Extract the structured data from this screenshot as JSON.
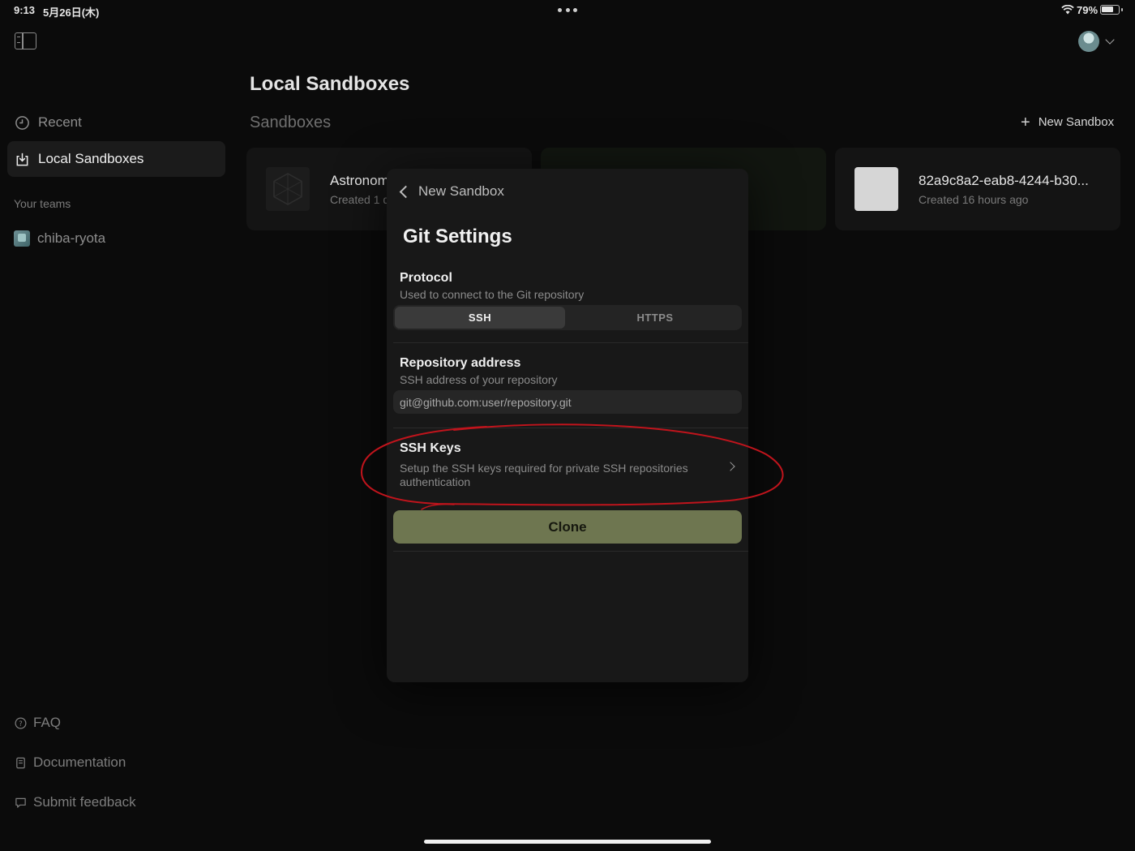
{
  "status_bar": {
    "time": "9:13",
    "date": "5月26日(木)",
    "battery_pct": "79%",
    "battery_level": 0.79
  },
  "sidebar": {
    "nav": [
      {
        "label": "Recent",
        "icon": "clock-icon"
      },
      {
        "label": "Local Sandboxes",
        "icon": "download-tray-icon",
        "selected": true
      }
    ],
    "teams_header": "Your teams",
    "teams": [
      {
        "label": "chiba-ryota"
      }
    ],
    "footer": [
      {
        "label": "FAQ",
        "icon": "question-circle-icon"
      },
      {
        "label": "Documentation",
        "icon": "document-icon"
      },
      {
        "label": "Submit feedback",
        "icon": "chat-bubble-icon"
      }
    ]
  },
  "main": {
    "title": "Local Sandboxes",
    "section": "Sandboxes",
    "new_sandbox_label": "New Sandbox",
    "cards": [
      {
        "name": "Astronom",
        "meta": "Created 1 d"
      },
      {
        "name": "",
        "meta": ""
      },
      {
        "name": "82a9c8a2-eab8-4244-b30...",
        "meta": "Created 16 hours ago"
      }
    ]
  },
  "modal": {
    "back_label": "New Sandbox",
    "title": "Git Settings",
    "protocol": {
      "label": "Protocol",
      "desc": "Used to connect to the Git repository",
      "options": [
        "SSH",
        "HTTPS"
      ],
      "selected": "SSH"
    },
    "repo": {
      "label": "Repository address",
      "desc": "SSH address of your repository",
      "placeholder": "git@github.com:user/repository.git"
    },
    "ssh_keys": {
      "label": "SSH Keys",
      "desc_line1": "Setup the SSH keys required for private SSH repositories",
      "desc_line2": "authentication"
    },
    "clone_label": "Clone"
  },
  "colors": {
    "accent_button": "#6e7650",
    "annotation": "#c0141c",
    "background": "#0b0b0b"
  }
}
